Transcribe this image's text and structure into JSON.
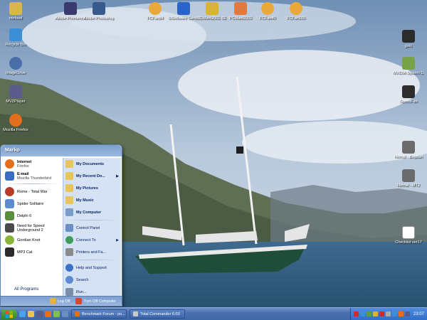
{
  "desktop_icons": [
    {
      "name": "mirfood",
      "label": "mirfood",
      "color": "#d9b64a"
    },
    {
      "name": "recycle-bin",
      "label": "Recycle Bin",
      "color": "#3b8fd6"
    },
    {
      "name": "imagedrive",
      "label": "ImageDrive",
      "color": "#4a6ea8"
    },
    {
      "name": "mvzplayer",
      "label": "MVZPlayer",
      "color": "#5b5b8c"
    },
    {
      "name": "mozilla-firefox",
      "label": "Mozilla Firefox",
      "color": "#e36e1b"
    },
    {
      "name": "adobe-premiere",
      "label": "Adobe Premiere Pro",
      "color": "#3a3a6e"
    },
    {
      "name": "adobe-photoshop",
      "label": "Adobe Photoshop 7.0",
      "color": "#375a8c"
    },
    {
      "name": "fcfan84",
      "label": "FCFan84",
      "color": "#e8a93a"
    },
    {
      "name": "siso-sandra",
      "label": "SiSoftware Sandra S...",
      "color": "#2a63c9"
    },
    {
      "name": "3dmark2001",
      "label": "3DMark2001 SE",
      "color": "#d9b238"
    },
    {
      "name": "pcmark2002",
      "label": "PCMark2002",
      "color": "#e2783b"
    },
    {
      "name": "fcfan2",
      "label": "FCFan40",
      "color": "#e8a93a"
    },
    {
      "name": "fcfan3",
      "label": "FCFan165",
      "color": "#e8a93a"
    },
    {
      "name": "gsrc",
      "label": "gsrc",
      "color": "#2b2b2b"
    },
    {
      "name": "nvidia-system",
      "label": "NVIDIA System Drive",
      "color": "#78a14a"
    },
    {
      "name": "speedfan",
      "label": "SpeedFan",
      "color": "#2d2d2d"
    },
    {
      "name": "hemal-bogdan",
      "label": "Hemal - Bogdan",
      "color": "#6b6b6b"
    },
    {
      "name": "hemal-mr",
      "label": "Hemal - MT2",
      "color": "#6b6b6b"
    },
    {
      "name": "checklist-txt",
      "label": "Checklist ver17",
      "color": "#ffffff"
    }
  ],
  "start_menu": {
    "user": "Marko",
    "pinned": [
      {
        "name": "internet",
        "main": "Internet",
        "sub": "Firefox",
        "color": "#e36e1b"
      },
      {
        "name": "email",
        "main": "E-mail",
        "sub": "Mozilla Thunderbird",
        "color": "#3a6fc4"
      }
    ],
    "recent": [
      {
        "name": "rome-total-war",
        "label": "Rome - Total War",
        "color": "#b83b2a"
      },
      {
        "name": "spider-solitaire",
        "label": "Spider Solitaire",
        "color": "#5c8ccf"
      },
      {
        "name": "delphi-6",
        "label": "Delphi 6",
        "color": "#5b8d3c"
      },
      {
        "name": "need-for-speed",
        "label": "Need for Speed Underground 2",
        "color": "#4a4a4a"
      },
      {
        "name": "gordian-knot",
        "label": "Gordian Knot",
        "color": "#8ab33a"
      },
      {
        "name": "mp3-cat",
        "label": "MP3 Cat",
        "color": "#2b2b2b"
      }
    ],
    "all_programs": "All Programs",
    "right": [
      {
        "name": "my-documents",
        "label": "My Documents",
        "bold": true,
        "color": "#e8c45a",
        "arrow": ""
      },
      {
        "name": "my-recent-documents",
        "label": "My Recent Do...",
        "bold": true,
        "color": "#e8c45a",
        "arrow": "▶"
      },
      {
        "name": "my-pictures",
        "label": "My Pictures",
        "bold": true,
        "color": "#e8c45a",
        "arrow": ""
      },
      {
        "name": "my-music",
        "label": "My Music",
        "bold": true,
        "color": "#e8c45a",
        "arrow": ""
      },
      {
        "name": "my-computer",
        "label": "My Computer",
        "bold": true,
        "color": "#7a9cc8",
        "arrow": ""
      },
      {
        "name": "control-panel",
        "label": "Control Panel",
        "bold": false,
        "color": "#6b8ec4",
        "arrow": ""
      },
      {
        "name": "connect-to",
        "label": "Connect To",
        "bold": false,
        "color": "#3d9c5a",
        "arrow": "▶"
      },
      {
        "name": "printers-and-faxes",
        "label": "Printers and Fa...",
        "bold": false,
        "color": "#8a8a8a",
        "arrow": ""
      },
      {
        "name": "help-and-support",
        "label": "Help and Support",
        "bold": false,
        "color": "#3a72c9",
        "arrow": ""
      },
      {
        "name": "search",
        "label": "Search",
        "bold": false,
        "color": "#5a8bd0",
        "arrow": ""
      },
      {
        "name": "run",
        "label": "Run...",
        "bold": false,
        "color": "#7a8ea8",
        "arrow": ""
      }
    ],
    "log_off": "Log Off",
    "turn_off": "Turn Off Computer"
  },
  "taskbar": {
    "tasks": [
      {
        "name": "task-benchmark",
        "label": "Benchmark Forum - po...",
        "color": "#e36e1b"
      },
      {
        "name": "task-total-commander",
        "label": "Total Commander 6.03",
        "color": "#c9c9c9"
      }
    ],
    "clock": "23:07",
    "tray_colors": [
      "#c9302c",
      "#3b8fd6",
      "#5b9e3a",
      "#d9b238",
      "#c9302c",
      "#aaaaaa",
      "#3b8fd6",
      "#e36e1b",
      "#5b5b8c"
    ]
  }
}
